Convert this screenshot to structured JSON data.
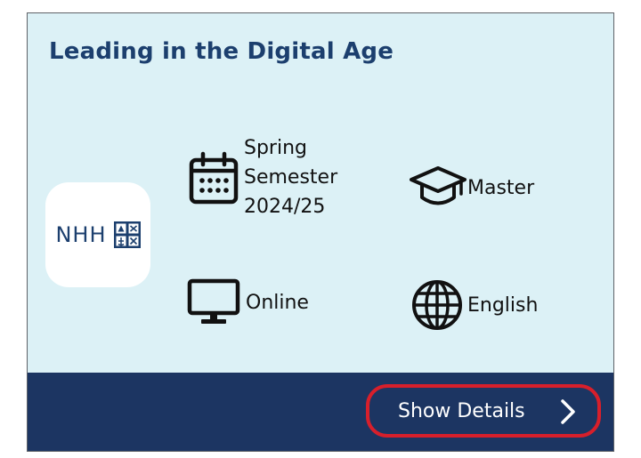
{
  "card": {
    "title": "Leading in the Digital Age",
    "logo": {
      "text": "NHH"
    },
    "details": {
      "semester": "Spring\nSemester\n2024/25",
      "level": "Master",
      "mode": "Online",
      "language": "English"
    },
    "footer": {
      "button_label": "Show Details"
    },
    "icons": {
      "semester": "calendar-icon",
      "level": "graduation-cap-icon",
      "mode": "monitor-icon",
      "language": "globe-icon",
      "button": "chevron-right-icon"
    },
    "colors": {
      "card_background": "#dcf1f6",
      "title": "#1c3f6e",
      "footer": "#1c3562",
      "highlight": "#d71f2b"
    }
  }
}
